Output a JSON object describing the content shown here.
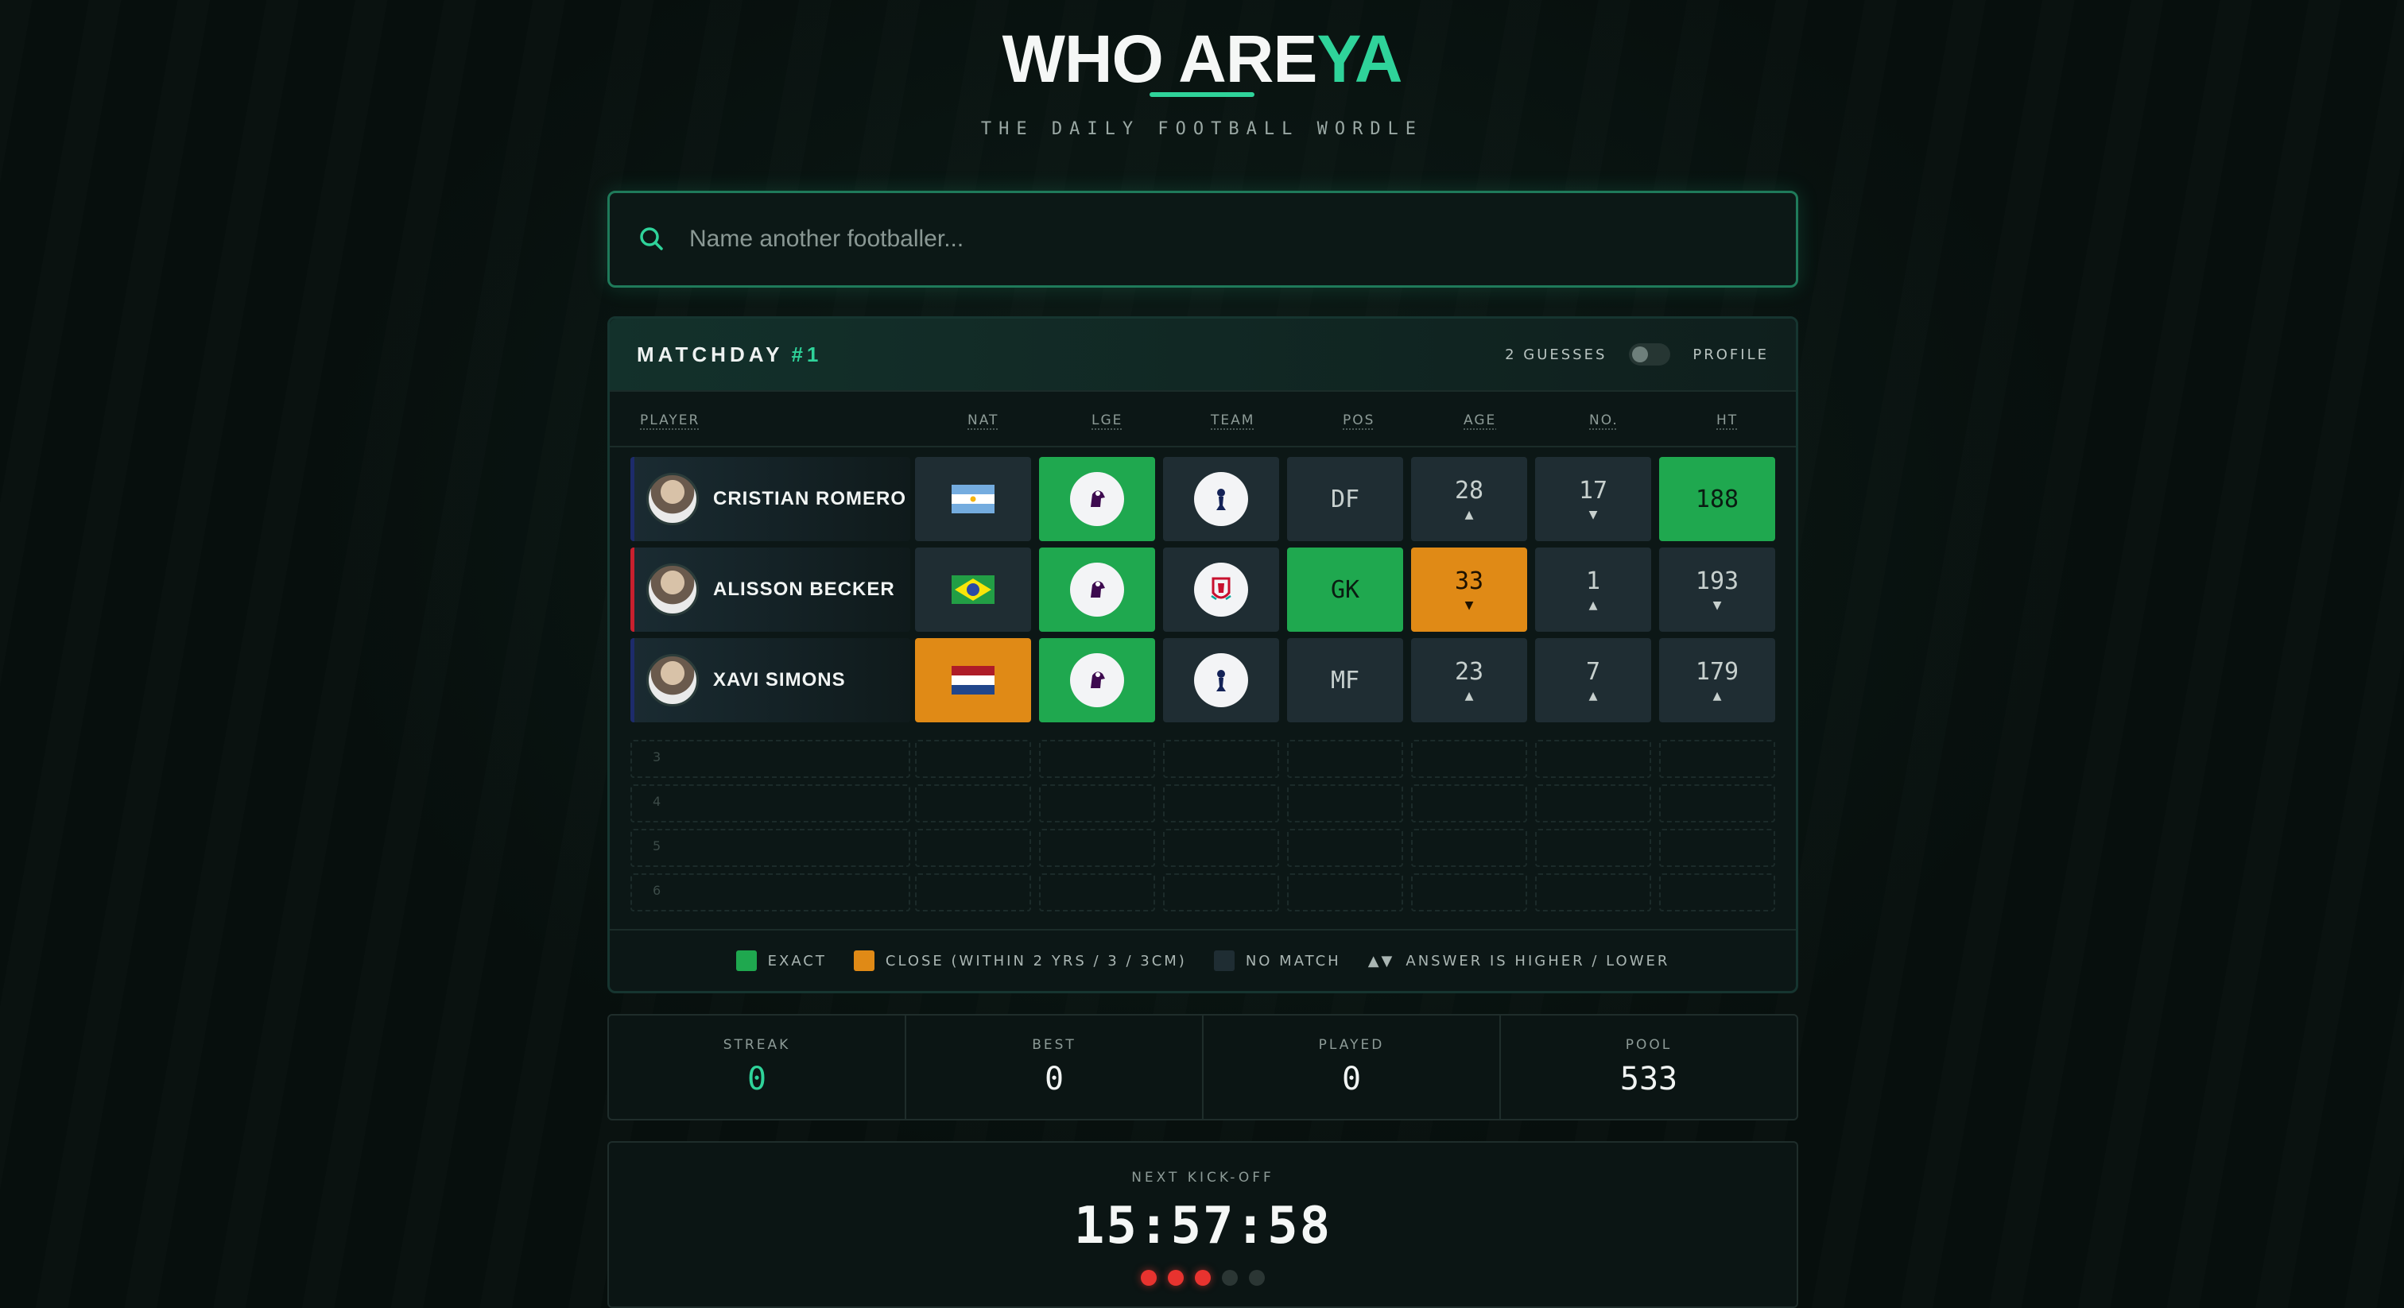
{
  "header": {
    "title_main": "WHO ARE",
    "title_accent": "YA",
    "subtitle": "THE DAILY FOOTBALL WORDLE"
  },
  "search": {
    "placeholder": "Name another footballer...",
    "value": "",
    "icon": "search-icon"
  },
  "board": {
    "matchday_label": "MATCHDAY",
    "matchday_number": "#1",
    "guesses_label": "2 GUESSES",
    "profile_toggle": {
      "label": "PROFILE",
      "on": false
    },
    "columns": [
      "PLAYER",
      "NAT",
      "LGE",
      "TEAM",
      "POS",
      "AGE",
      "NO.",
      "HT"
    ],
    "rows": [
      {
        "name": "CRISTIAN ROMERO",
        "stripe_color": "#1d2b6b",
        "nat": {
          "flag": "argentina-flag",
          "status": "none"
        },
        "lge": {
          "icon": "premier-league-icon",
          "status": "exact"
        },
        "team": {
          "icon": "tottenham-crest-icon",
          "status": "none"
        },
        "pos": {
          "value": "DF",
          "status": "none"
        },
        "age": {
          "value": "28",
          "arrow": "▲",
          "status": "none"
        },
        "no": {
          "value": "17",
          "arrow": "▼",
          "status": "none"
        },
        "ht": {
          "value": "188",
          "arrow": "",
          "status": "exact"
        }
      },
      {
        "name": "ALISSON BECKER",
        "stripe_color": "#c8202e",
        "nat": {
          "flag": "brazil-flag",
          "status": "none"
        },
        "lge": {
          "icon": "premier-league-icon",
          "status": "exact"
        },
        "team": {
          "icon": "liverpool-crest-icon",
          "status": "none"
        },
        "pos": {
          "value": "GK",
          "status": "exact"
        },
        "age": {
          "value": "33",
          "arrow": "▼",
          "status": "close"
        },
        "no": {
          "value": "1",
          "arrow": "▲",
          "status": "none"
        },
        "ht": {
          "value": "193",
          "arrow": "▼",
          "status": "none"
        }
      },
      {
        "name": "XAVI SIMONS",
        "stripe_color": "#1d2b6b",
        "nat": {
          "flag": "netherlands-flag",
          "status": "close"
        },
        "lge": {
          "icon": "premier-league-icon",
          "status": "exact"
        },
        "team": {
          "icon": "tottenham-crest-icon",
          "status": "none"
        },
        "pos": {
          "value": "MF",
          "status": "none"
        },
        "age": {
          "value": "23",
          "arrow": "▲",
          "status": "none"
        },
        "no": {
          "value": "7",
          "arrow": "▲",
          "status": "none"
        },
        "ht": {
          "value": "179",
          "arrow": "▲",
          "status": "none"
        }
      }
    ],
    "empty_rows": [
      "3",
      "4",
      "5",
      "6"
    ],
    "legend": {
      "exact": "EXACT",
      "close": "CLOSE (WITHIN 2 YRS / 3 / 3CM)",
      "none": "NO MATCH",
      "arrows_symbol": "▲▼",
      "arrows": "ANSWER IS HIGHER / LOWER"
    }
  },
  "stats": [
    {
      "label": "STREAK",
      "value": "0",
      "accent": true
    },
    {
      "label": "BEST",
      "value": "0",
      "accent": false
    },
    {
      "label": "PLAYED",
      "value": "0",
      "accent": false
    },
    {
      "label": "POOL",
      "value": "533",
      "accent": false
    }
  ],
  "kickoff": {
    "label": "NEXT KICK-OFF",
    "timer": "15:57:58",
    "dots_filled": 3,
    "dots_total": 5
  },
  "colors": {
    "accent": "#2fd39a",
    "exact": "#1fa84f",
    "close": "#e08a16",
    "none": "#1f2d33",
    "dot_on": "#e8332f"
  }
}
